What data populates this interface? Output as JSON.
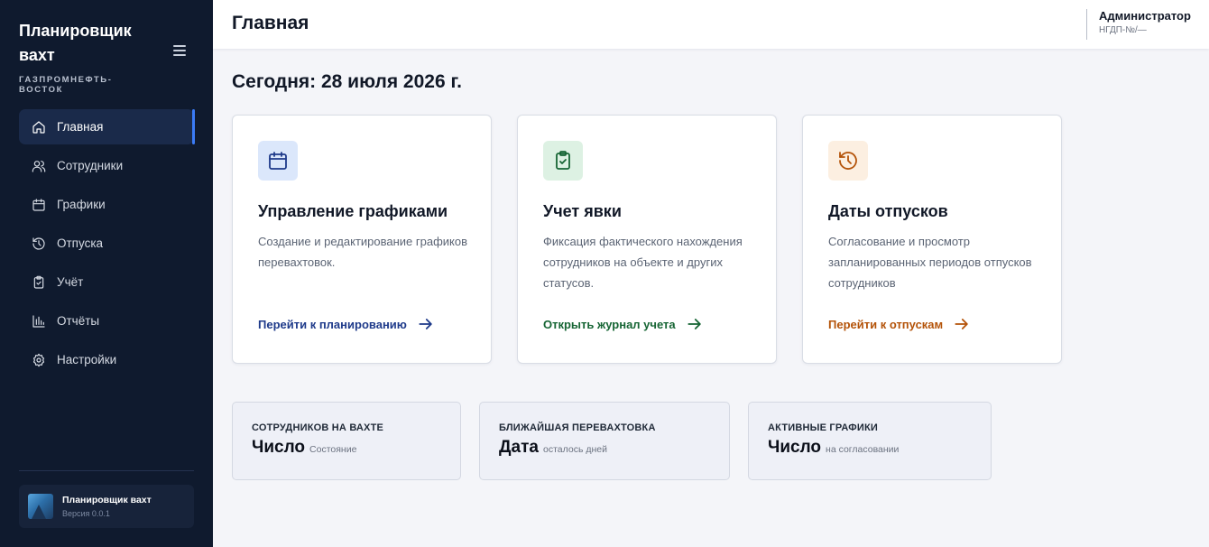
{
  "sidebar": {
    "brand_title": "Планировщик вахт",
    "brand_subtitle": "ГАЗПРОМНЕФТЬ-ВОСТОК",
    "items": [
      {
        "label": "Главная",
        "icon": "home-icon",
        "active": true
      },
      {
        "label": "Сотрудники",
        "icon": "users-icon"
      },
      {
        "label": "Графики",
        "icon": "calendar-icon"
      },
      {
        "label": "Отпуска",
        "icon": "history-icon"
      },
      {
        "label": "Учёт",
        "icon": "clipboard-check-icon"
      },
      {
        "label": "Отчёты",
        "icon": "bar-chart-icon"
      },
      {
        "label": "Настройки",
        "icon": "gear-icon"
      }
    ],
    "app_name": "Планировщик вахт",
    "app_version": "Версия 0.0.1"
  },
  "header": {
    "title": "Главная",
    "user_name": "Администратор",
    "user_org": "НГДП-№/—"
  },
  "main": {
    "today": "Сегодня: 28 июля 2026 г.",
    "cards": [
      {
        "title": "Управление графиками",
        "description": "Создание и редактирование графиков перевахтовок.",
        "link": "Перейти к планированию",
        "icon": "calendar-icon",
        "accent": "#1e3a8a",
        "icon_bg": "#dbe7fb"
      },
      {
        "title": "Учет явки",
        "description": "Фиксация фактического нахождения сотрудников на объекте и других статусов.",
        "link": "Открыть журнал учета",
        "icon": "clipboard-check-icon",
        "accent": "#166534",
        "icon_bg": "#ddf1e3"
      },
      {
        "title": "Даты отпусков",
        "description": "Согласование и просмотр запланированных периодов отпусков сотрудников",
        "link": "Перейти к отпускам",
        "icon": "history-icon",
        "accent": "#b45309",
        "icon_bg": "#fcefe1"
      }
    ],
    "stats": [
      {
        "label": "СОТРУДНИКОВ НА ВАХТЕ",
        "value": "Число",
        "sub": "Состояние"
      },
      {
        "label": "БЛИЖАЙШАЯ ПЕРЕВАХТОВКА",
        "value": "Дата",
        "sub": "осталось дней"
      },
      {
        "label": "АКТИВНЫЕ ГРАФИКИ",
        "value": "Число",
        "sub": "на согласовании"
      }
    ]
  }
}
